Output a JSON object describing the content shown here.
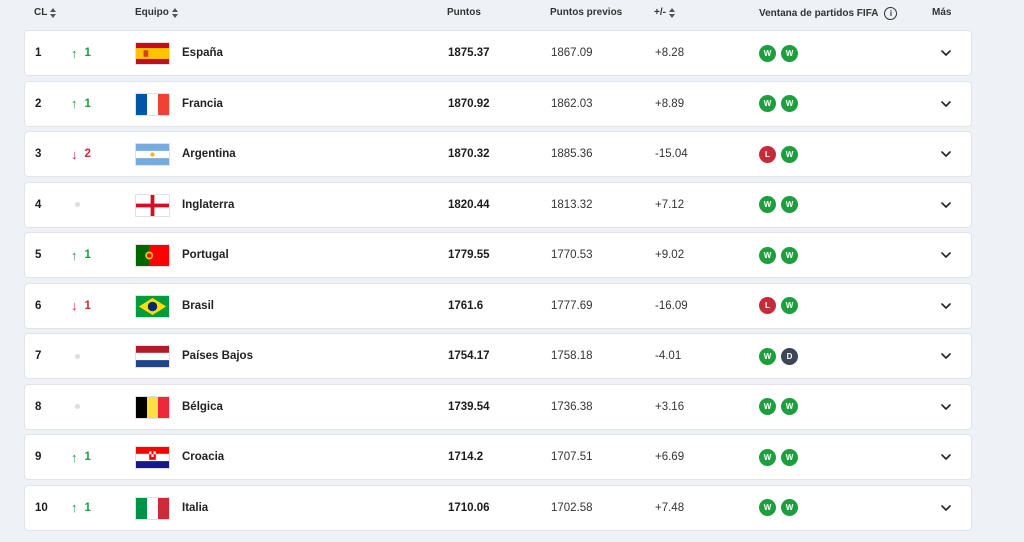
{
  "header": {
    "rank": "CL",
    "team": "Equipo",
    "points": "Puntos",
    "prev_points": "Puntos previos",
    "diff": "+/-",
    "window": "Ventana de partidos FIFA",
    "more": "Más"
  },
  "icons": {
    "sort": "sort-icon",
    "info": "info-icon",
    "expand": "chevron-down-icon",
    "up": "arrow-up-icon",
    "down": "arrow-down-icon"
  },
  "colors": {
    "win": "#1e9e3e",
    "loss": "#c42b3b",
    "draw": "#3d4658",
    "up": "#1e9e3e",
    "down": "#c42b3b"
  },
  "rows": [
    {
      "rank": "1",
      "move": "up",
      "move_value": "1",
      "team": "España",
      "flag": "es",
      "points": "1875.37",
      "prev": "1867.09",
      "diff": "+8.28",
      "results": [
        "W",
        "W"
      ]
    },
    {
      "rank": "2",
      "move": "up",
      "move_value": "1",
      "team": "Francia",
      "flag": "fr",
      "points": "1870.92",
      "prev": "1862.03",
      "diff": "+8.89",
      "results": [
        "W",
        "W"
      ]
    },
    {
      "rank": "3",
      "move": "down",
      "move_value": "2",
      "team": "Argentina",
      "flag": "ar",
      "points": "1870.32",
      "prev": "1885.36",
      "diff": "-15.04",
      "results": [
        "L",
        "W"
      ]
    },
    {
      "rank": "4",
      "move": "same",
      "move_value": "",
      "team": "Inglaterra",
      "flag": "en",
      "points": "1820.44",
      "prev": "1813.32",
      "diff": "+7.12",
      "results": [
        "W",
        "W"
      ]
    },
    {
      "rank": "5",
      "move": "up",
      "move_value": "1",
      "team": "Portugal",
      "flag": "pt",
      "points": "1779.55",
      "prev": "1770.53",
      "diff": "+9.02",
      "results": [
        "W",
        "W"
      ]
    },
    {
      "rank": "6",
      "move": "down",
      "move_value": "1",
      "team": "Brasil",
      "flag": "br",
      "points": "1761.6",
      "prev": "1777.69",
      "diff": "-16.09",
      "results": [
        "L",
        "W"
      ]
    },
    {
      "rank": "7",
      "move": "same",
      "move_value": "",
      "team": "Países Bajos",
      "flag": "nl",
      "points": "1754.17",
      "prev": "1758.18",
      "diff": "-4.01",
      "results": [
        "W",
        "D"
      ]
    },
    {
      "rank": "8",
      "move": "same",
      "move_value": "",
      "team": "Bélgica",
      "flag": "be",
      "points": "1739.54",
      "prev": "1736.38",
      "diff": "+3.16",
      "results": [
        "W",
        "W"
      ]
    },
    {
      "rank": "9",
      "move": "up",
      "move_value": "1",
      "team": "Croacia",
      "flag": "hr",
      "points": "1714.2",
      "prev": "1707.51",
      "diff": "+6.69",
      "results": [
        "W",
        "W"
      ]
    },
    {
      "rank": "10",
      "move": "up",
      "move_value": "1",
      "team": "Italia",
      "flag": "it",
      "points": "1710.06",
      "prev": "1702.58",
      "diff": "+7.48",
      "results": [
        "W",
        "W"
      ]
    }
  ]
}
